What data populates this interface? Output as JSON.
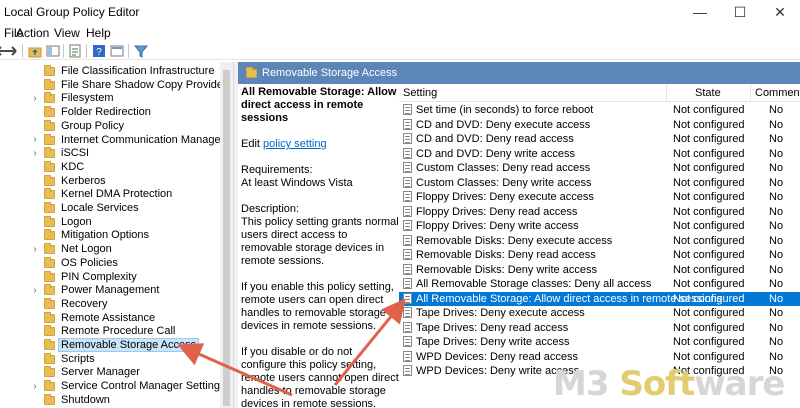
{
  "app": {
    "title": "Local Group Policy Editor"
  },
  "menu": [
    "File",
    "Action",
    "View",
    "Help"
  ],
  "toolbar_icons": [
    "back-icon",
    "forward-icon",
    "folder-up-icon",
    "show-hide-tree-icon",
    "export-icon",
    "help-icon",
    "properties-icon",
    "filter-icon"
  ],
  "tree": {
    "items": [
      {
        "label": "File Classification Infrastructure",
        "expandable": false
      },
      {
        "label": "File Share Shadow Copy Provider",
        "expandable": false
      },
      {
        "label": "Filesystem",
        "expandable": true
      },
      {
        "label": "Folder Redirection",
        "expandable": false
      },
      {
        "label": "Group Policy",
        "expandable": false
      },
      {
        "label": "Internet Communication Management",
        "expandable": true
      },
      {
        "label": "iSCSI",
        "expandable": true
      },
      {
        "label": "KDC",
        "expandable": false
      },
      {
        "label": "Kerberos",
        "expandable": false
      },
      {
        "label": "Kernel DMA Protection",
        "expandable": false
      },
      {
        "label": "Locale Services",
        "expandable": false
      },
      {
        "label": "Logon",
        "expandable": false
      },
      {
        "label": "Mitigation Options",
        "expandable": false
      },
      {
        "label": "Net Logon",
        "expandable": true
      },
      {
        "label": "OS Policies",
        "expandable": false
      },
      {
        "label": "PIN Complexity",
        "expandable": false
      },
      {
        "label": "Power Management",
        "expandable": true
      },
      {
        "label": "Recovery",
        "expandable": false
      },
      {
        "label": "Remote Assistance",
        "expandable": false
      },
      {
        "label": "Remote Procedure Call",
        "expandable": false
      },
      {
        "label": "Removable Storage Access",
        "expandable": false,
        "selected": true
      },
      {
        "label": "Scripts",
        "expandable": false
      },
      {
        "label": "Server Manager",
        "expandable": false
      },
      {
        "label": "Service Control Manager Settings",
        "expandable": true
      },
      {
        "label": "Shutdown",
        "expandable": false
      }
    ]
  },
  "pane": {
    "header": "Removable Storage Access",
    "description": {
      "title": "All Removable Storage: Allow direct access in remote sessions",
      "edit_prefix": "Edit ",
      "edit_link": "policy setting",
      "requirements_label": "Requirements:",
      "requirements_value": "At least Windows Vista",
      "description_label": "Description:",
      "description_text": "This policy setting grants normal users direct access to removable storage devices in remote sessions.",
      "enabled_text": "If you enable this policy setting, remote users can open direct handles to removable storage devices in remote sessions.",
      "disabled_text": "If you disable or do not configure this policy setting, remote users cannot open direct handles to removable storage devices in remote sessions."
    }
  },
  "list": {
    "columns": {
      "setting": "Setting",
      "state": "State",
      "comment": "Comment"
    },
    "rows": [
      {
        "setting": "Set time (in seconds) to force reboot",
        "state": "Not configured",
        "comment": "No"
      },
      {
        "setting": "CD and DVD: Deny execute access",
        "state": "Not configured",
        "comment": "No"
      },
      {
        "setting": "CD and DVD: Deny read access",
        "state": "Not configured",
        "comment": "No"
      },
      {
        "setting": "CD and DVD: Deny write access",
        "state": "Not configured",
        "comment": "No"
      },
      {
        "setting": "Custom Classes: Deny read access",
        "state": "Not configured",
        "comment": "No"
      },
      {
        "setting": "Custom Classes: Deny write access",
        "state": "Not configured",
        "comment": "No"
      },
      {
        "setting": "Floppy Drives: Deny execute access",
        "state": "Not configured",
        "comment": "No"
      },
      {
        "setting": "Floppy Drives: Deny read access",
        "state": "Not configured",
        "comment": "No"
      },
      {
        "setting": "Floppy Drives: Deny write access",
        "state": "Not configured",
        "comment": "No"
      },
      {
        "setting": "Removable Disks: Deny execute access",
        "state": "Not configured",
        "comment": "No"
      },
      {
        "setting": "Removable Disks: Deny read access",
        "state": "Not configured",
        "comment": "No"
      },
      {
        "setting": "Removable Disks: Deny write access",
        "state": "Not configured",
        "comment": "No"
      },
      {
        "setting": "All Removable Storage classes: Deny all access",
        "state": "Not configured",
        "comment": "No"
      },
      {
        "setting": "All Removable Storage: Allow direct access in remote sessions",
        "state": "Not configured",
        "comment": "No",
        "selected": true
      },
      {
        "setting": "Tape Drives: Deny execute access",
        "state": "Not configured",
        "comment": "No"
      },
      {
        "setting": "Tape Drives: Deny read access",
        "state": "Not configured",
        "comment": "No"
      },
      {
        "setting": "Tape Drives: Deny write access",
        "state": "Not configured",
        "comment": "No"
      },
      {
        "setting": "WPD Devices: Deny read access",
        "state": "Not configured",
        "comment": "No"
      },
      {
        "setting": "WPD Devices: Deny write access",
        "state": "Not configured",
        "comment": "No"
      }
    ]
  },
  "watermark": {
    "prefix": "M3 ",
    "accent": "Soft",
    "suffix": "ware"
  },
  "colors": {
    "selection": "#0078d7",
    "header": "#5d86b8",
    "arrow": "#e0624b",
    "link": "#0066cc"
  }
}
